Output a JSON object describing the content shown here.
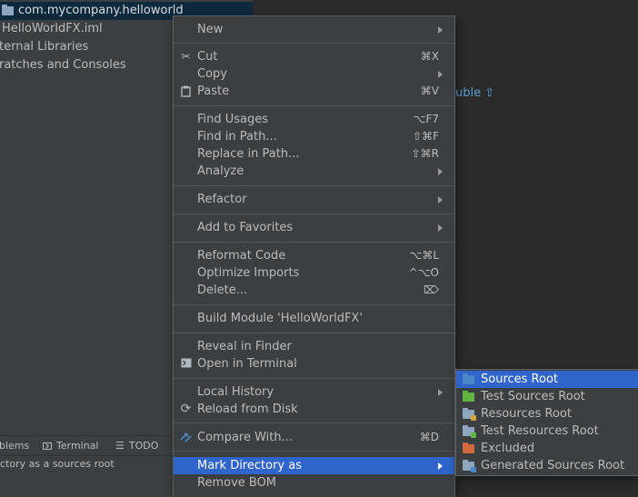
{
  "project_tree": {
    "items": [
      {
        "label": "com.mycompany.helloworld",
        "selected": true,
        "icon": "package-folder-icon"
      },
      {
        "label": "HelloWorldFX.iml"
      },
      {
        "label": "ternal Libraries"
      },
      {
        "label": "ratches and Consoles"
      }
    ]
  },
  "tool_window_bar": {
    "problems": "blems",
    "terminal": "Terminal",
    "todo": "TODO"
  },
  "status_bar": {
    "text": "ctory as a sources root"
  },
  "editor": {
    "hint_text": "uble ⇧"
  },
  "context_menu": {
    "new": {
      "label": "New"
    },
    "cut": {
      "label": "Cut",
      "shortcut": "⌘X",
      "icon": "scissors-icon"
    },
    "copy": {
      "label": "Copy"
    },
    "paste": {
      "label": "Paste",
      "shortcut": "⌘V",
      "icon": "clipboard-icon"
    },
    "find_usages": {
      "label": "Find Usages",
      "shortcut": "⌥F7"
    },
    "find_in_path": {
      "label": "Find in Path...",
      "shortcut": "⇧⌘F"
    },
    "replace_in_path": {
      "label": "Replace in Path...",
      "shortcut": "⇧⌘R"
    },
    "analyze": {
      "label": "Analyze"
    },
    "refactor": {
      "label": "Refactor"
    },
    "add_to_favorites": {
      "label": "Add to Favorites"
    },
    "reformat_code": {
      "label": "Reformat Code",
      "shortcut": "⌥⌘L"
    },
    "optimize_imports": {
      "label": "Optimize Imports",
      "shortcut": "^⌥O"
    },
    "delete": {
      "label": "Delete...",
      "shortcut": "⌦"
    },
    "build_module": {
      "label": "Build Module 'HelloWorldFX'"
    },
    "reveal_in_finder": {
      "label": "Reveal in Finder"
    },
    "open_in_terminal": {
      "label": "Open in Terminal",
      "icon": "terminal-icon"
    },
    "local_history": {
      "label": "Local History"
    },
    "reload_from_disk": {
      "label": "Reload from Disk",
      "icon": "refresh-icon"
    },
    "compare_with": {
      "label": "Compare With...",
      "shortcut": "⌘D",
      "icon": "compare-arrows-icon"
    },
    "mark_directory_as": {
      "label": "Mark Directory as",
      "active": true
    },
    "remove_bom": {
      "label": "Remove BOM"
    }
  },
  "submenu": {
    "items": [
      {
        "label": "Sources Root",
        "icon": "sources-root-folder-icon",
        "color": "#4a86c8",
        "active": true
      },
      {
        "label": "Test Sources Root",
        "icon": "test-sources-root-folder-icon",
        "color": "#62b543"
      },
      {
        "label": "Resources Root",
        "icon": "resources-root-folder-icon",
        "color": "#8fa6bf",
        "badge_color": "#d2a23c"
      },
      {
        "label": "Test Resources Root",
        "icon": "test-resources-root-folder-icon",
        "color": "#8fa6bf",
        "badge_color": "#62b543"
      },
      {
        "label": "Excluded",
        "icon": "excluded-folder-icon",
        "color": "#d1683e"
      },
      {
        "label": "Generated Sources Root",
        "icon": "generated-sources-root-folder-icon",
        "color": "#8fa6bf",
        "badge_color": "#4a86c8"
      }
    ]
  }
}
